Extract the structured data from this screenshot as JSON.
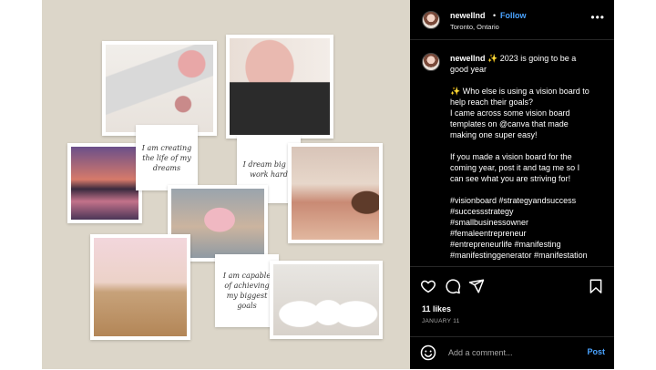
{
  "post": {
    "username": "newellnd",
    "dot": "•",
    "follow_label": "Follow",
    "location": "Toronto, Ontario",
    "more_label": "•••",
    "caption_lines": [
      "✨ 2023 is going to be a",
      "good year"
    ],
    "body_lines": [
      "✨ Who else is using a vision board to",
      "help reach their goals?",
      "I came across some vision board",
      "templates on @canva that made",
      "making one super easy!"
    ],
    "body2_lines": [
      "If you made a vision board for the",
      "coming year, post it and tag me so I",
      "can see what you are striving for!"
    ],
    "hashtag_lines": [
      "#visionboard #strategyandsuccess",
      "#successstrategy",
      "#smallbusinessowner",
      "#femaleentrepreneur",
      "#entrepreneurlife #manifesting",
      "#manifestinggenerator #manifestation"
    ],
    "likes": "11 likes",
    "date": "JANUARY 11",
    "comment_placeholder": "Add a comment...",
    "post_label": "Post"
  },
  "media": {
    "quotes": [
      "I am creating the life of my dreams",
      "I dream big & work hard",
      "I am capable of achieving my biggest goals"
    ]
  },
  "icons": {
    "heart": "heart-icon",
    "comment": "comment-icon",
    "share": "share-icon",
    "save": "bookmark-icon",
    "emoji": "emoji-icon"
  },
  "colors": {
    "accent": "#4aa3ff",
    "panel": "#000000",
    "board_background": "#dcd6c9"
  }
}
